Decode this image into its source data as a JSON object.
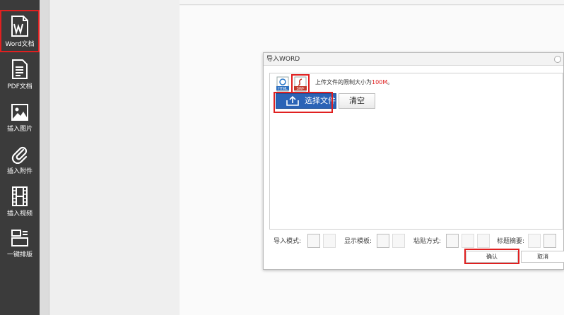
{
  "sidebar": {
    "items": [
      {
        "label": "Word文档",
        "icon": "word-doc-icon"
      },
      {
        "label": "PDF文档",
        "icon": "pdf-doc-icon"
      },
      {
        "label": "插入图片",
        "icon": "image-icon"
      },
      {
        "label": "插入附件",
        "icon": "paperclip-icon"
      },
      {
        "label": "插入视频",
        "icon": "film-icon"
      },
      {
        "label": "一键排版",
        "icon": "layout-icon"
      }
    ]
  },
  "dialog": {
    "title": "导入WORD",
    "formats": [
      {
        "label": "HTML",
        "icon": "html-format-icon"
      },
      {
        "label": "SWF",
        "icon": "swf-format-icon"
      }
    ],
    "hint_prefix": "上传文件的限制大小为",
    "hint_limit": "100M",
    "hint_suffix": "。",
    "choose_label": "选择文件",
    "clear_label": "清空",
    "options": {
      "import_mode_label": "导入模式:",
      "display_template_label": "显示模板:",
      "paste_mode_label": "粘贴方式:",
      "title_summary_label": "标题摘要:"
    },
    "ok_label": "确认",
    "cancel_label": "取消"
  },
  "colors": {
    "sidebar_bg": "#3b3b3b",
    "primary_button": "#2b63b6",
    "highlight": "#e02020"
  }
}
